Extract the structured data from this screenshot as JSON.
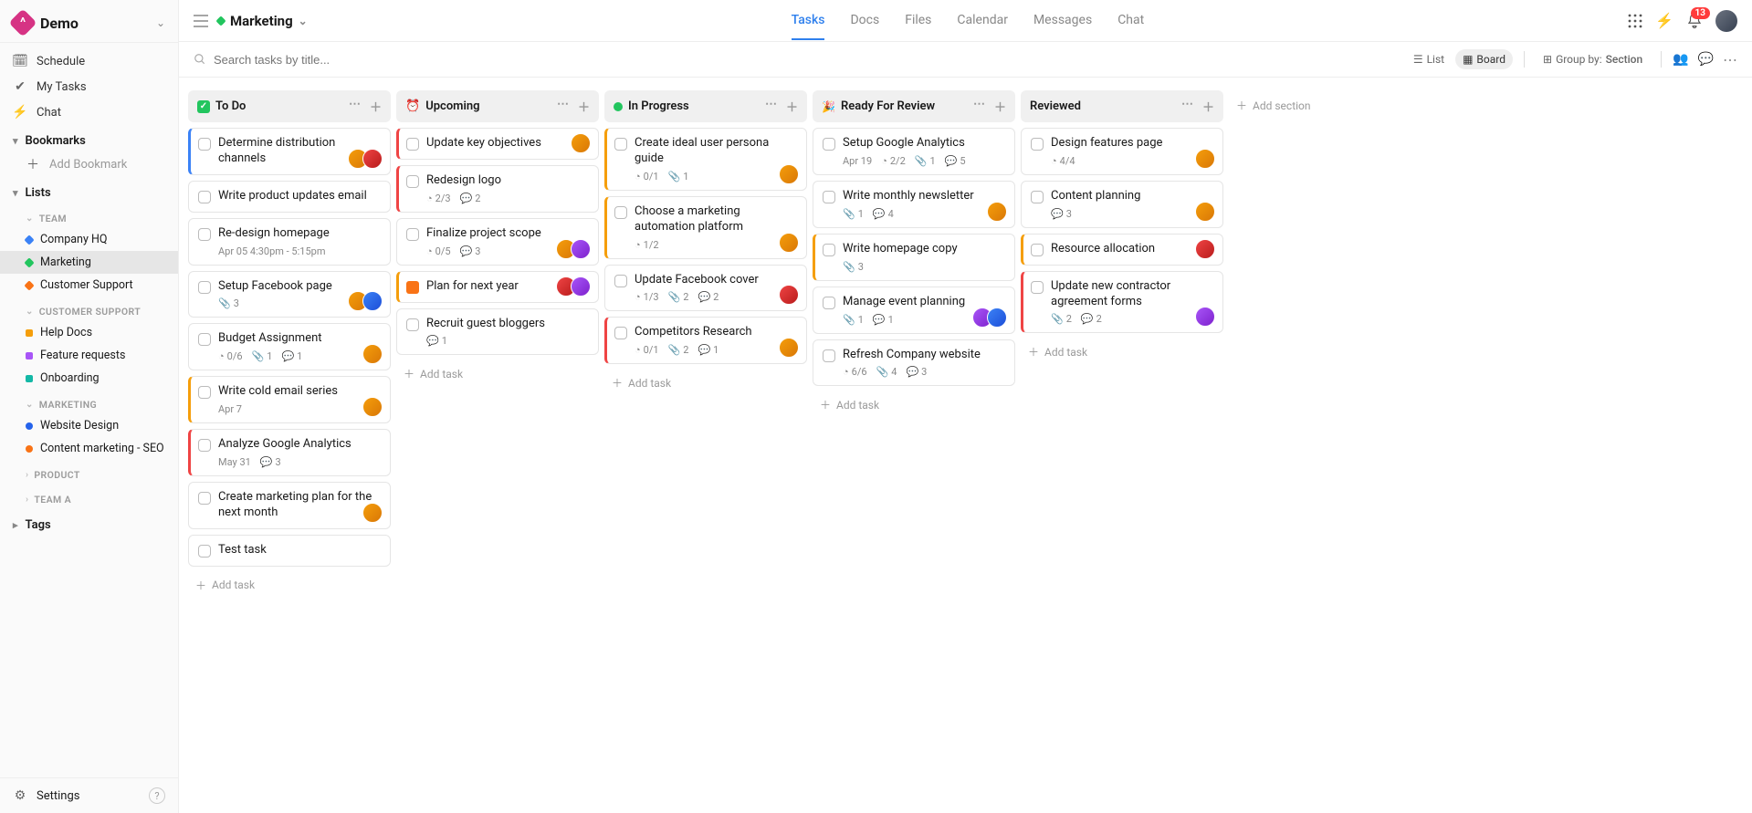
{
  "workspace": {
    "name": "Demo"
  },
  "sidebar": {
    "schedule": "Schedule",
    "mytasks": "My Tasks",
    "chat": "Chat",
    "bookmarks_hdr": "Bookmarks",
    "add_bookmark": "Add Bookmark",
    "lists_hdr": "Lists",
    "groups": {
      "team": {
        "label": "TEAM",
        "items": [
          {
            "label": "Company HQ",
            "color": "#3b82f6",
            "shape": "diamond"
          },
          {
            "label": "Marketing",
            "color": "#22c55e",
            "shape": "diamond",
            "active": true
          },
          {
            "label": "Customer Support",
            "color": "#f97316",
            "shape": "diamond"
          }
        ]
      },
      "customer_support": {
        "label": "CUSTOMER SUPPORT",
        "items": [
          {
            "label": "Help Docs",
            "color": "#f59e0b",
            "shape": "square"
          },
          {
            "label": "Feature requests",
            "color": "#a855f7",
            "shape": "square"
          },
          {
            "label": "Onboarding",
            "color": "#14b8a6",
            "shape": "square"
          }
        ]
      },
      "marketing": {
        "label": "MARKETING",
        "items": [
          {
            "label": "Website Design",
            "color": "#2563eb",
            "shape": "round"
          },
          {
            "label": "Content marketing - SEO",
            "color": "#f97316",
            "shape": "round"
          }
        ]
      },
      "product": {
        "label": "PRODUCT"
      },
      "team_a": {
        "label": "TEAM A"
      }
    },
    "tags": "Tags",
    "settings": "Settings"
  },
  "topbar": {
    "list_title": "Marketing",
    "tabs": [
      "Tasks",
      "Docs",
      "Files",
      "Calendar",
      "Messages",
      "Chat"
    ],
    "active_tab": 0,
    "notification_count": "13"
  },
  "subbar": {
    "search_placeholder": "Search tasks by title...",
    "view_list": "List",
    "view_board": "Board",
    "group_by_label": "Group by:",
    "group_by_value": "Section",
    "add_section": "Add section"
  },
  "board": {
    "add_task": "Add task",
    "columns": [
      {
        "title": "To Do",
        "icon": "check-green",
        "cards": [
          {
            "title": "Determine distribution channels",
            "stripe": "blue",
            "avatars": [
              "a1",
              "a3"
            ]
          },
          {
            "title": "Write product updates email"
          },
          {
            "title": "Re-design homepage",
            "meta_date": "Apr 05 4:30pm - 5:15pm"
          },
          {
            "title": "Setup Facebook page",
            "attach": "3",
            "avatars": [
              "a1",
              "a4"
            ]
          },
          {
            "title": "Budget Assignment",
            "subtasks": "0/6",
            "attach": "1",
            "comments": "1",
            "avatars": [
              "a1"
            ]
          },
          {
            "title": "Write cold email series",
            "stripe": "orange",
            "meta_date": "Apr 7",
            "avatars": [
              "a1"
            ]
          },
          {
            "title": "Analyze Google Analytics",
            "stripe": "red",
            "meta_date": "May 31",
            "comments": "3"
          },
          {
            "title": "Create marketing plan for the next month",
            "avatars": [
              "a1"
            ]
          },
          {
            "title": "Test task"
          }
        ]
      },
      {
        "title": "Upcoming",
        "icon": "clock-orange",
        "cards": [
          {
            "title": "Update key objectives",
            "stripe": "red",
            "avatars": [
              "a1"
            ]
          },
          {
            "title": "Redesign logo",
            "stripe": "red",
            "subtasks": "2/3",
            "comments": "2"
          },
          {
            "title": "Finalize project scope",
            "subtasks": "0/5",
            "comments": "3",
            "avatars": [
              "a1",
              "a5"
            ]
          },
          {
            "title": "Plan for next year",
            "stripe": "orange",
            "avatars": [
              "a3",
              "a5"
            ],
            "icon_left": "square-orange"
          },
          {
            "title": "Recruit guest bloggers",
            "comments": "1"
          }
        ]
      },
      {
        "title": "In Progress",
        "icon": "dot-green",
        "cards": [
          {
            "title": "Create ideal user persona guide",
            "stripe": "orange",
            "subtasks": "0/1",
            "attach": "1",
            "avatars": [
              "a1"
            ]
          },
          {
            "title": "Choose a marketing automation platform",
            "stripe": "orange",
            "subtasks": "1/2",
            "avatars": [
              "a1"
            ]
          },
          {
            "title": "Update Facebook cover",
            "subtasks": "1/3",
            "attach": "2",
            "comments": "2",
            "avatars": [
              "a3"
            ]
          },
          {
            "title": "Competitors Research",
            "stripe": "red",
            "subtasks": "0/1",
            "attach": "2",
            "comments": "1",
            "avatars": [
              "a1"
            ]
          }
        ]
      },
      {
        "title": "Ready For Review",
        "icon": "sparkle",
        "cards": [
          {
            "title": "Setup Google Analytics",
            "meta_date": "Apr 19",
            "subtasks": "2/2",
            "attach": "1",
            "comments": "5"
          },
          {
            "title": "Write monthly newsletter",
            "attach": "1",
            "comments": "4",
            "avatars": [
              "a1"
            ]
          },
          {
            "title": "Write homepage copy",
            "stripe": "orange",
            "attach": "3"
          },
          {
            "title": "Manage event planning",
            "attach": "1",
            "comments": "1",
            "avatars": [
              "a5",
              "a4"
            ]
          },
          {
            "title": "Refresh Company website",
            "subtasks": "6/6",
            "attach": "4",
            "comments": "3"
          }
        ]
      },
      {
        "title": "Reviewed",
        "icon": "none",
        "cards": [
          {
            "title": "Design features page",
            "subtasks": "4/4",
            "avatars": [
              "a1"
            ]
          },
          {
            "title": "Content planning",
            "comments": "3",
            "avatars": [
              "a1"
            ]
          },
          {
            "title": "Resource allocation",
            "stripe": "orange",
            "avatars": [
              "a3"
            ]
          },
          {
            "title": "Update new contractor agreement forms",
            "stripe": "red",
            "attach": "2",
            "comments": "2",
            "avatars": [
              "a5"
            ]
          }
        ]
      }
    ]
  }
}
